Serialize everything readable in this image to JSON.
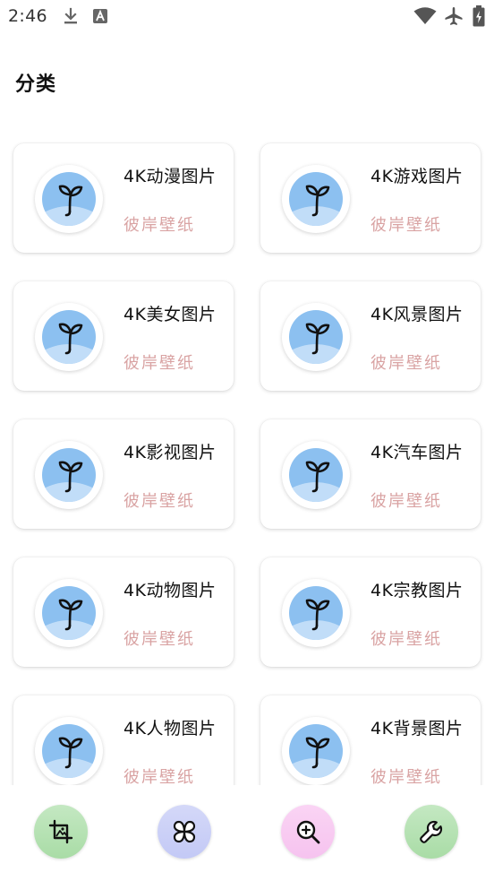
{
  "status_bar": {
    "time": "2:46",
    "icons": [
      "download-icon",
      "text-icon",
      "wifi-icon",
      "airplane-mode-icon",
      "battery-charging-icon"
    ]
  },
  "page": {
    "title": "分类"
  },
  "categories": [
    {
      "title": "4K动漫图片",
      "subtitle": "彼岸壁纸",
      "icon": "sprout-icon"
    },
    {
      "title": "4K游戏图片",
      "subtitle": "彼岸壁纸",
      "icon": "sprout-icon"
    },
    {
      "title": "4K美女图片",
      "subtitle": "彼岸壁纸",
      "icon": "sprout-icon"
    },
    {
      "title": "4K风景图片",
      "subtitle": "彼岸壁纸",
      "icon": "sprout-icon"
    },
    {
      "title": "4K影视图片",
      "subtitle": "彼岸壁纸",
      "icon": "sprout-icon"
    },
    {
      "title": "4K汽车图片",
      "subtitle": "彼岸壁纸",
      "icon": "sprout-icon"
    },
    {
      "title": "4K动物图片",
      "subtitle": "彼岸壁纸",
      "icon": "sprout-icon"
    },
    {
      "title": "4K宗教图片",
      "subtitle": "彼岸壁纸",
      "icon": "sprout-icon"
    },
    {
      "title": "4K人物图片",
      "subtitle": "彼岸壁纸",
      "icon": "sprout-icon"
    },
    {
      "title": "4K背景图片",
      "subtitle": "彼岸壁纸",
      "icon": "sprout-icon"
    }
  ],
  "bottom_nav": [
    {
      "icon": "crop-image-icon",
      "color": "#a9dca6"
    },
    {
      "icon": "clover-icon",
      "color": "#c3c9f6"
    },
    {
      "icon": "search-plus-icon",
      "color": "#f6c3ef"
    },
    {
      "icon": "wrench-icon",
      "color": "#a9dca6"
    }
  ],
  "colors": {
    "subtitle": "#d9a3a3",
    "avatar_blue": "#8cc0f0",
    "avatar_light_blue": "#c1ddf8"
  }
}
